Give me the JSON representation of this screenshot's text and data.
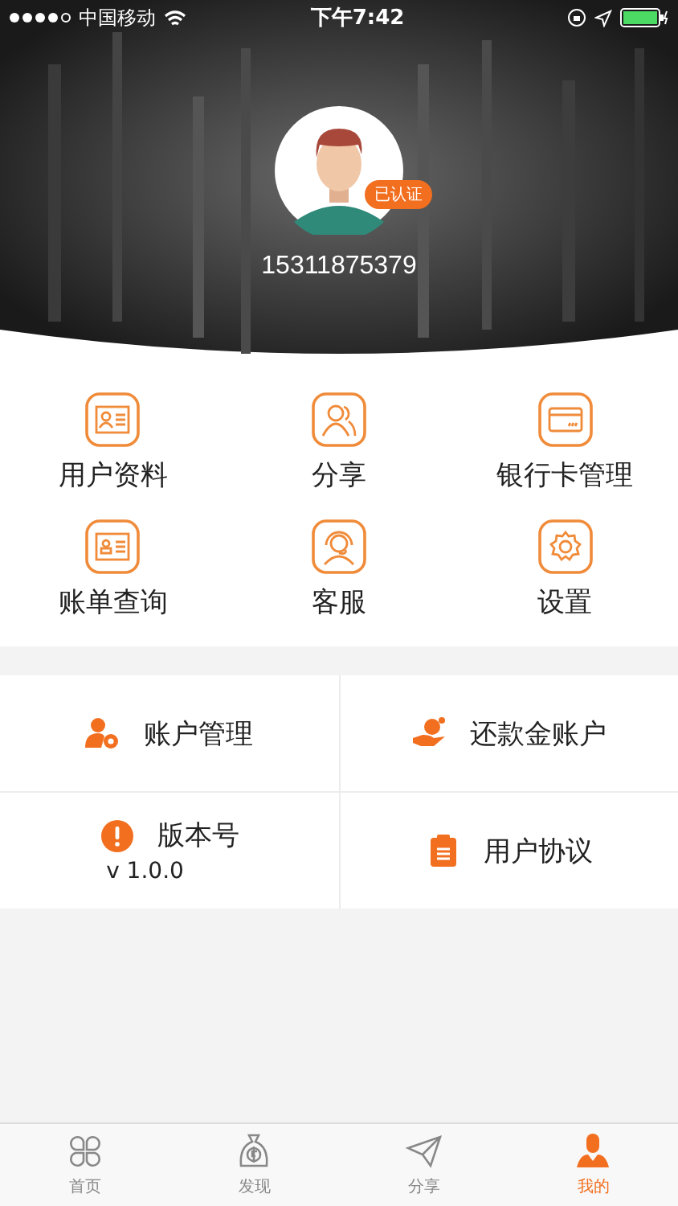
{
  "status_bar": {
    "carrier": "中国移动",
    "time": "下午7:42"
  },
  "profile": {
    "badge": "已认证",
    "phone": "15311875379"
  },
  "grid": [
    {
      "label": "用户资料"
    },
    {
      "label": "分享"
    },
    {
      "label": "银行卡管理"
    },
    {
      "label": "账单查询"
    },
    {
      "label": "客服"
    },
    {
      "label": "设置"
    }
  ],
  "menu": [
    {
      "label": "账户管理"
    },
    {
      "label": "还款金账户"
    },
    {
      "label": "版本号",
      "sub": "v 1.0.0"
    },
    {
      "label": "用户协议"
    }
  ],
  "tabs": [
    {
      "label": "首页",
      "selected": false
    },
    {
      "label": "发现",
      "selected": false
    },
    {
      "label": "分享",
      "selected": false
    },
    {
      "label": "我的",
      "selected": true
    }
  ]
}
